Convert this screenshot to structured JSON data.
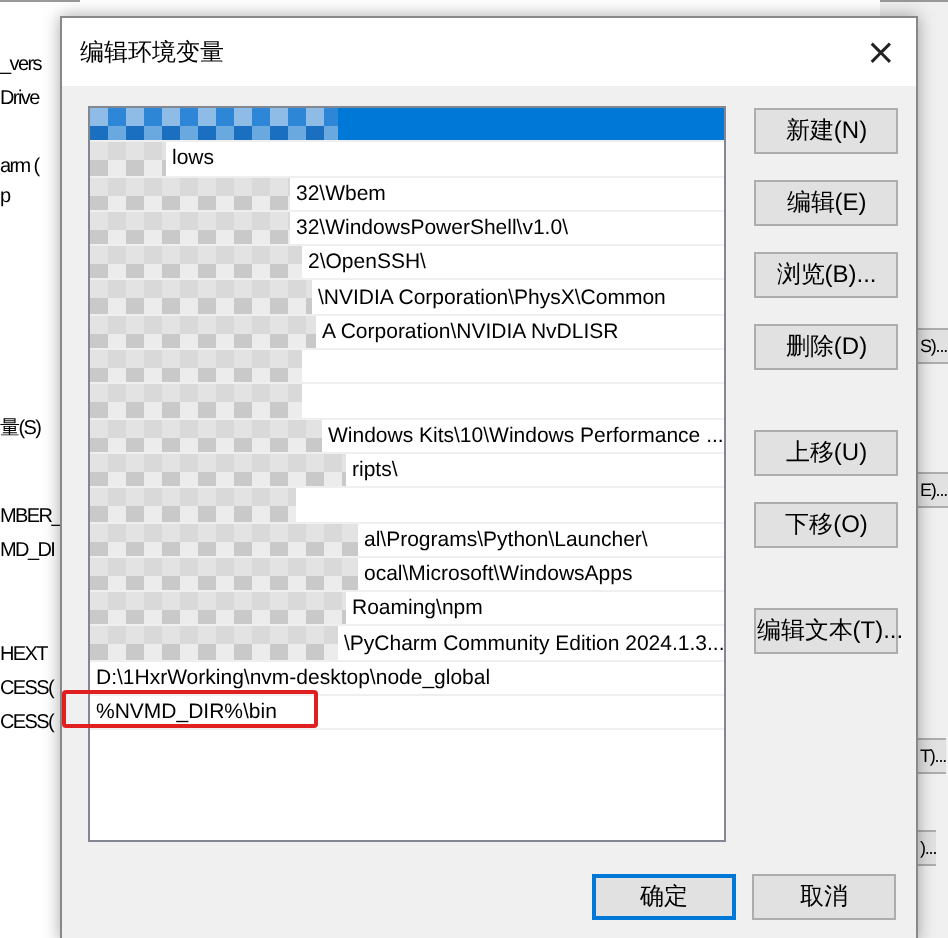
{
  "background_window": {
    "left_labels": [
      "_vers",
      "Drive",
      "arm (",
      "p",
      "量(S)",
      "MBER_",
      "MD_DI",
      "HEXT",
      "CESS(",
      "CESS("
    ],
    "right_labels": [
      "S)...",
      "E)...",
      "T)...",
      ")..."
    ]
  },
  "dialog": {
    "title": "编辑环境变量",
    "close": "×",
    "paths": [
      {
        "selected": true,
        "pixelated": true,
        "highlighted": false
      },
      {
        "text": "lows",
        "selected": false,
        "pixelated": true,
        "highlighted": false
      },
      {
        "text": "32\\Wbem",
        "selected": false,
        "pixelated": true,
        "highlighted": false
      },
      {
        "text": "32\\WindowsPowerShell\\v1.0\\",
        "selected": false,
        "pixelated": true,
        "highlighted": false
      },
      {
        "text": "2\\OpenSSH\\",
        "selected": false,
        "pixelated": true,
        "highlighted": false
      },
      {
        "text": "\\NVIDIA Corporation\\PhysX\\Common",
        "selected": false,
        "pixelated": true,
        "highlighted": false
      },
      {
        "text": "A Corporation\\NVIDIA NvDLISR",
        "selected": false,
        "pixelated": true,
        "highlighted": false
      },
      {
        "selected": false,
        "pixelated": true,
        "highlighted": false
      },
      {
        "selected": false,
        "pixelated": true,
        "highlighted": false
      },
      {
        "text": "Windows Kits\\10\\Windows Performance ...",
        "selected": false,
        "pixelated": true,
        "highlighted": false
      },
      {
        "text": "ripts\\",
        "selected": false,
        "pixelated": true,
        "highlighted": false
      },
      {
        "selected": false,
        "pixelated": true,
        "highlighted": false
      },
      {
        "text": "al\\Programs\\Python\\Launcher\\",
        "selected": false,
        "pixelated": true,
        "highlighted": false
      },
      {
        "text": "ocal\\Microsoft\\WindowsApps",
        "selected": false,
        "pixelated": true,
        "highlighted": false
      },
      {
        "text": "Roaming\\npm",
        "selected": false,
        "pixelated": true,
        "highlighted": false
      },
      {
        "text": "\\PyCharm Community Edition 2024.1.3...",
        "selected": false,
        "pixelated": true,
        "highlighted": false
      },
      {
        "text": "D:\\1HxrWorking\\nvm-desktop\\node_global",
        "selected": false,
        "pixelated": false,
        "highlighted": false
      },
      {
        "text": "%NVMD_DIR%\\bin",
        "selected": false,
        "pixelated": false,
        "highlighted": true
      }
    ],
    "button_groups": [
      [
        "新建(N)",
        "编辑(E)",
        "浏览(B)...",
        "删除(D)"
      ],
      [
        "上移(U)",
        "下移(O)"
      ],
      [
        "编辑文本(T)..."
      ]
    ],
    "footer_buttons": [
      {
        "label": "确定",
        "default": true
      },
      {
        "label": "取消",
        "default": false
      }
    ]
  }
}
